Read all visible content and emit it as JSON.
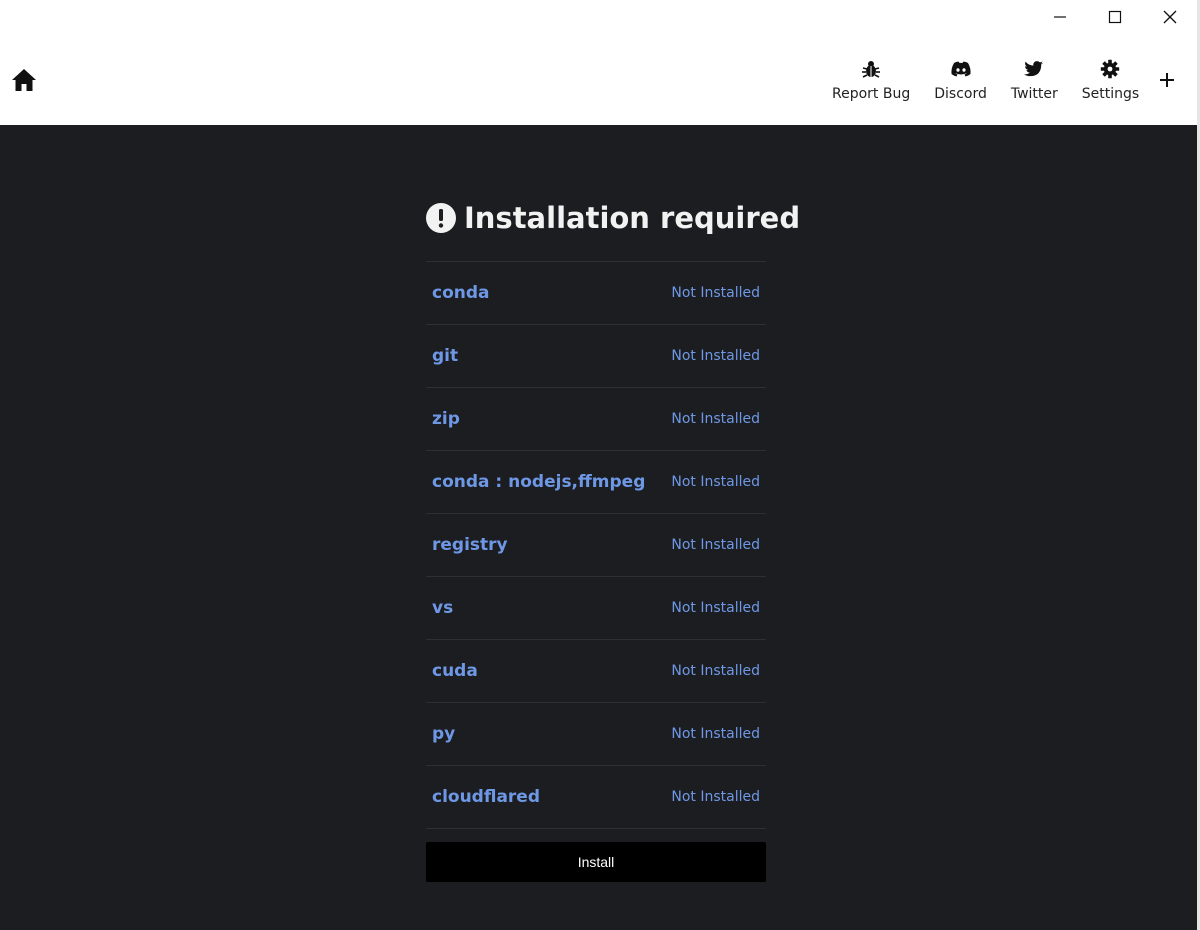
{
  "nav": {
    "items": [
      {
        "label": "Report Bug",
        "icon": "bug-icon"
      },
      {
        "label": "Discord",
        "icon": "discord-icon"
      },
      {
        "label": "Twitter",
        "icon": "twitter-icon"
      },
      {
        "label": "Settings",
        "icon": "gear-icon"
      }
    ]
  },
  "main": {
    "title": "Installation required",
    "requirements": [
      {
        "name": "conda",
        "status": "Not Installed"
      },
      {
        "name": "git",
        "status": "Not Installed"
      },
      {
        "name": "zip",
        "status": "Not Installed"
      },
      {
        "name": "conda : nodejs,ffmpeg",
        "status": "Not Installed"
      },
      {
        "name": "registry",
        "status": "Not Installed"
      },
      {
        "name": "vs",
        "status": "Not Installed"
      },
      {
        "name": "cuda",
        "status": "Not Installed"
      },
      {
        "name": "py",
        "status": "Not Installed"
      },
      {
        "name": "cloudflared",
        "status": "Not Installed"
      }
    ],
    "install_label": "Install"
  },
  "colors": {
    "accent": "#6e98e6",
    "background": "#1c1d20",
    "header": "#ffffff",
    "button": "#000000"
  }
}
